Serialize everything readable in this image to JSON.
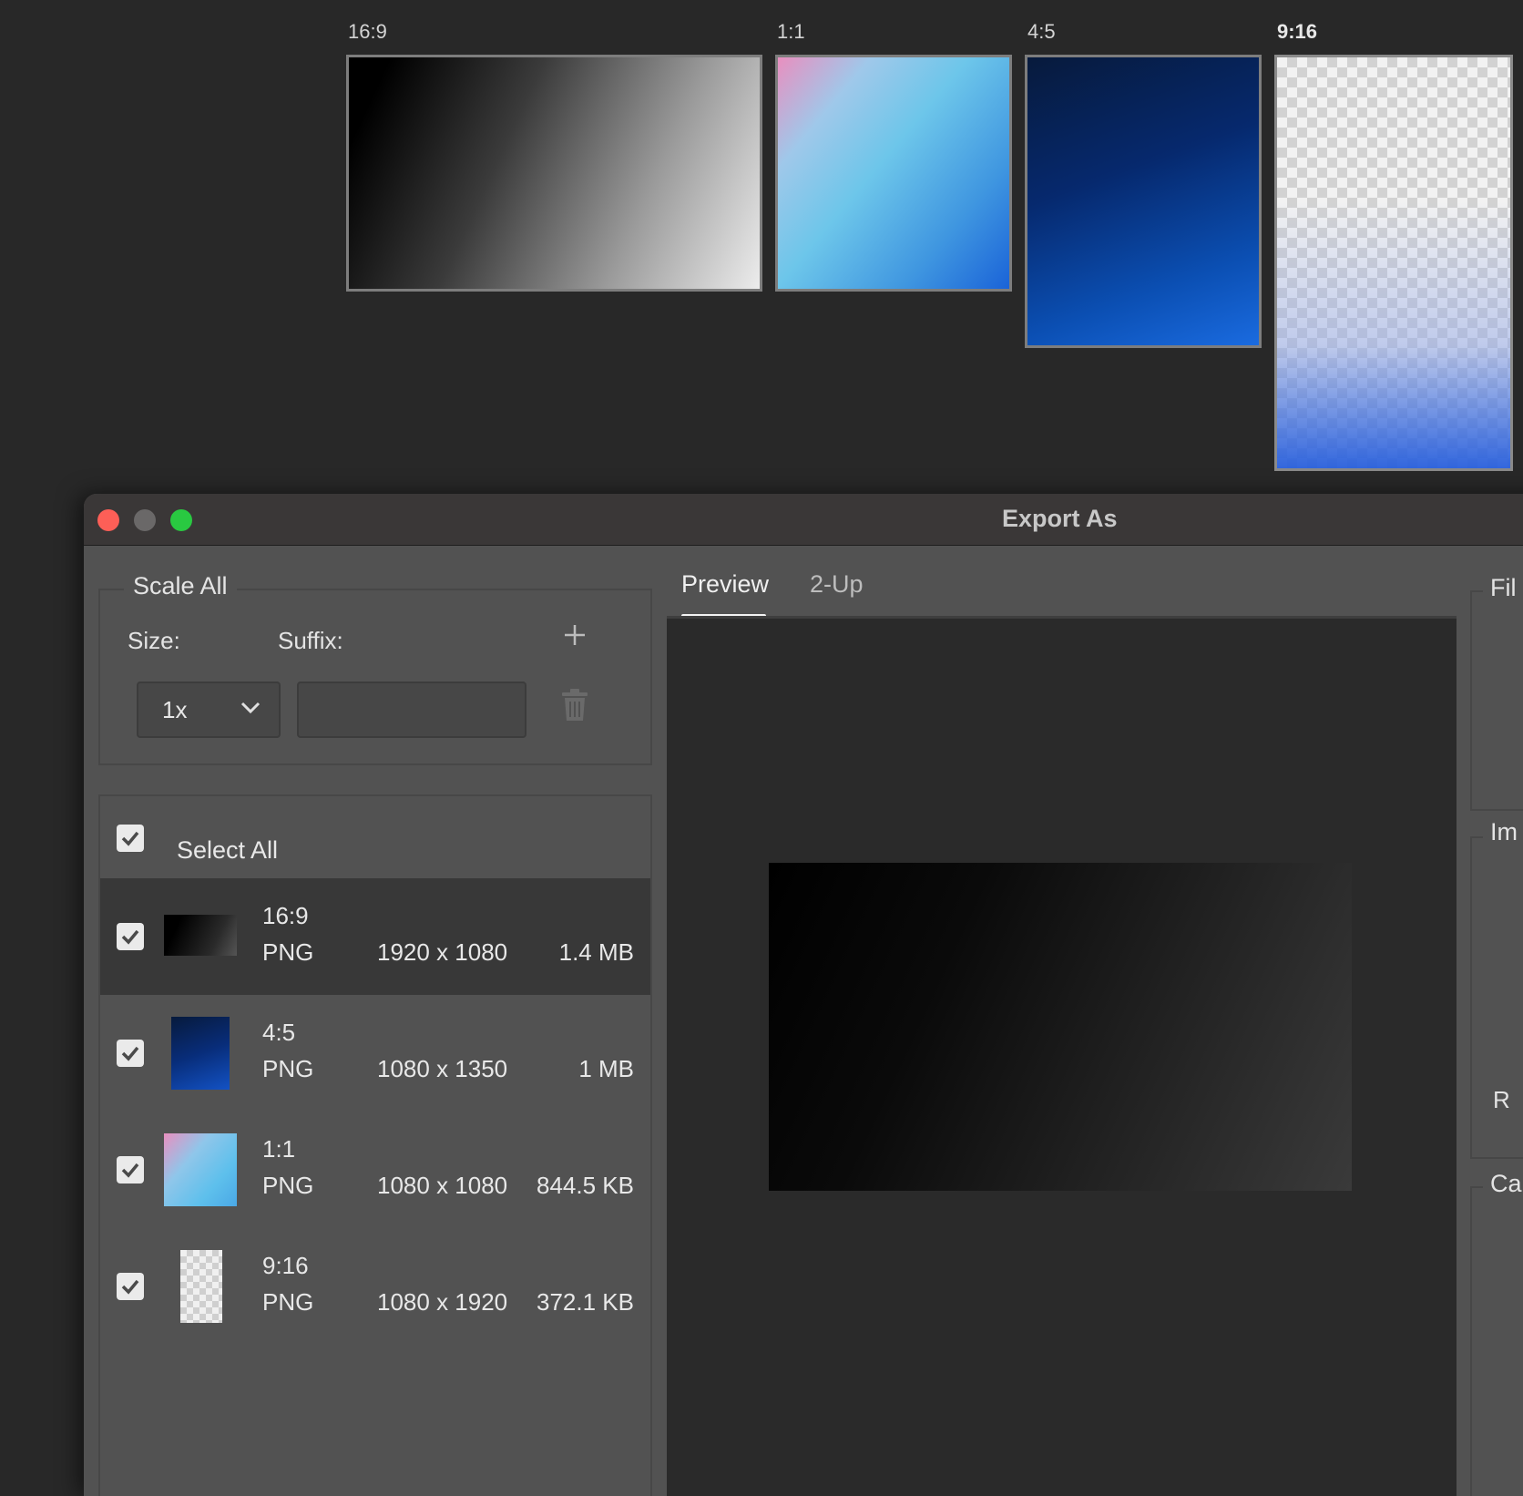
{
  "artboards": [
    {
      "label": "16:9"
    },
    {
      "label": "1:1"
    },
    {
      "label": "4:5"
    },
    {
      "label": "9:16"
    }
  ],
  "dialog": {
    "title": "Export As",
    "scale_all": {
      "legend": "Scale All",
      "size_label": "Size:",
      "suffix_label": "Suffix:",
      "size_value": "1x",
      "suffix_value": ""
    },
    "select_all_label": "Select All",
    "assets": [
      {
        "name": "16:9",
        "format": "PNG",
        "dimensions": "1920 x 1080",
        "file_size": "1.4 MB",
        "checked": true,
        "selected": true
      },
      {
        "name": "4:5",
        "format": "PNG",
        "dimensions": "1080 x 1350",
        "file_size": "1 MB",
        "checked": true
      },
      {
        "name": "1:1",
        "format": "PNG",
        "dimensions": "1080 x 1080",
        "file_size": "844.5 KB",
        "checked": true
      },
      {
        "name": "9:16",
        "format": "PNG",
        "dimensions": "1080 x 1920",
        "file_size": "372.1 KB",
        "checked": true
      }
    ],
    "tabs": [
      {
        "label": "Preview",
        "active": true
      },
      {
        "label": "2-Up"
      }
    ],
    "right_panel": {
      "file_legend": "Fil",
      "image_legend": "Im",
      "canvas_legend": "Ca",
      "resample_label": "R"
    }
  },
  "colors": {
    "close": "#fd5f57",
    "minimize": "#6a6868",
    "maximize": "#29c941",
    "panel_bg": "#525252",
    "canvas_bg": "#282828"
  },
  "icons": [
    "checkmark-icon",
    "chevron-down-icon",
    "plus-icon",
    "trash-icon"
  ]
}
